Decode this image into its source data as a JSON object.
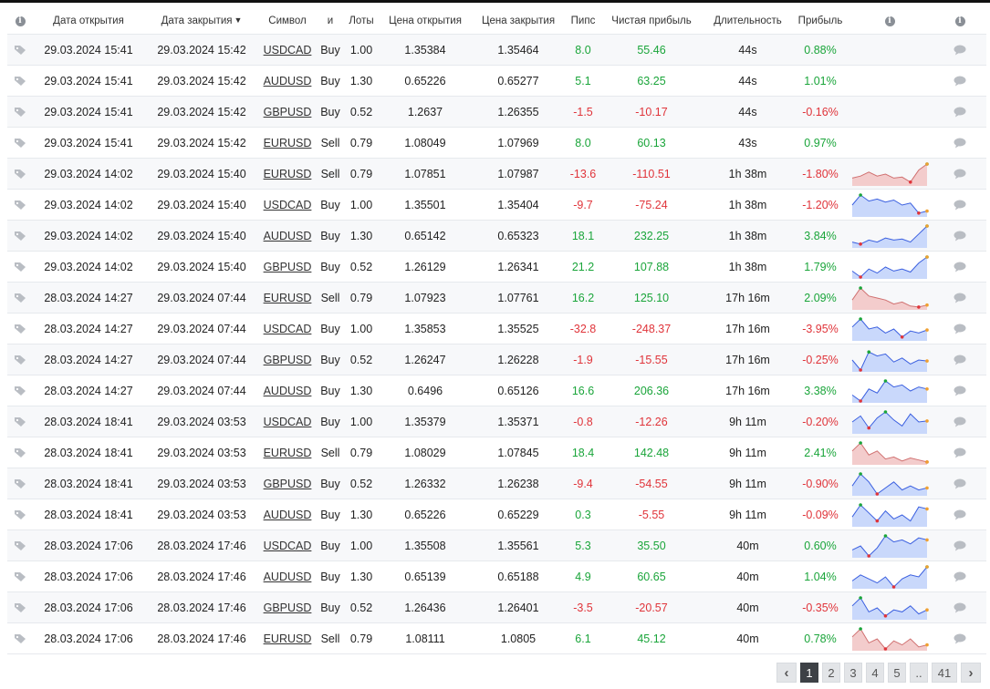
{
  "headers": {
    "open_date": "Дата открытия",
    "close_date": "Дата закрытия",
    "sort_glyph": "▼",
    "symbol": "Символ",
    "side": "и",
    "lots": "Лоты",
    "open_price": "Цена открытия",
    "close_price": "Цена закрытия",
    "pips": "Пипс",
    "net_profit": "Чистая прибыль",
    "duration": "Длительность",
    "gain": "Прибыль"
  },
  "colors": {
    "positive": "#1aa53a",
    "negative": "#e0343a",
    "spark_gain_fill": "#c9d8fb",
    "spark_gain_line": "#3a5fe0",
    "spark_loss_fill": "#f3cccc",
    "spark_loss_line": "#d07070"
  },
  "rows": [
    {
      "open": "29.03.2024 15:41",
      "close": "29.03.2024 15:42",
      "symbol": "USDCAD",
      "side": "Buy",
      "lots": "1.00",
      "open_price": "1.35384",
      "close_price": "1.35464",
      "pips": "8.0",
      "profit": "55.46",
      "duration": "44s",
      "gain": "0.88%",
      "sign": "pos",
      "spark": null
    },
    {
      "open": "29.03.2024 15:41",
      "close": "29.03.2024 15:42",
      "symbol": "AUDUSD",
      "side": "Buy",
      "lots": "1.30",
      "open_price": "0.65226",
      "close_price": "0.65277",
      "pips": "5.1",
      "profit": "63.25",
      "duration": "44s",
      "gain": "1.01%",
      "sign": "pos",
      "spark": null
    },
    {
      "open": "29.03.2024 15:41",
      "close": "29.03.2024 15:42",
      "symbol": "GBPUSD",
      "side": "Buy",
      "lots": "0.52",
      "open_price": "1.2637",
      "close_price": "1.26355",
      "pips": "-1.5",
      "profit": "-10.17",
      "duration": "44s",
      "gain": "-0.16%",
      "sign": "neg",
      "spark": null
    },
    {
      "open": "29.03.2024 15:41",
      "close": "29.03.2024 15:42",
      "symbol": "EURUSD",
      "side": "Sell",
      "lots": "0.79",
      "open_price": "1.08049",
      "close_price": "1.07969",
      "pips": "8.0",
      "profit": "60.13",
      "duration": "43s",
      "gain": "0.97%",
      "sign": "pos",
      "spark": null
    },
    {
      "open": "29.03.2024 14:02",
      "close": "29.03.2024 15:40",
      "symbol": "EURUSD",
      "side": "Sell",
      "lots": "0.79",
      "open_price": "1.07851",
      "close_price": "1.07987",
      "pips": "-13.6",
      "profit": "-110.51",
      "duration": "1h 38m",
      "gain": "-1.80%",
      "sign": "neg",
      "spark": "loss",
      "sv": [
        0.3,
        0.4,
        0.6,
        0.4,
        0.5,
        0.3,
        0.35,
        0.1,
        0.7,
        1.0
      ]
    },
    {
      "open": "29.03.2024 14:02",
      "close": "29.03.2024 15:40",
      "symbol": "USDCAD",
      "side": "Buy",
      "lots": "1.00",
      "open_price": "1.35501",
      "close_price": "1.35404",
      "pips": "-9.7",
      "profit": "-75.24",
      "duration": "1h 38m",
      "gain": "-1.20%",
      "sign": "neg",
      "spark": "gain",
      "sv": [
        0.5,
        1.0,
        0.7,
        0.8,
        0.65,
        0.75,
        0.5,
        0.6,
        0.1,
        0.2
      ]
    },
    {
      "open": "29.03.2024 14:02",
      "close": "29.03.2024 15:40",
      "symbol": "AUDUSD",
      "side": "Buy",
      "lots": "1.30",
      "open_price": "0.65142",
      "close_price": "0.65323",
      "pips": "18.1",
      "profit": "232.25",
      "duration": "1h 38m",
      "gain": "3.84%",
      "sign": "pos",
      "spark": "gain",
      "sv": [
        0.2,
        0.1,
        0.3,
        0.2,
        0.4,
        0.3,
        0.35,
        0.2,
        0.6,
        1.0
      ]
    },
    {
      "open": "29.03.2024 14:02",
      "close": "29.03.2024 15:40",
      "symbol": "GBPUSD",
      "side": "Buy",
      "lots": "0.52",
      "open_price": "1.26129",
      "close_price": "1.26341",
      "pips": "21.2",
      "profit": "107.88",
      "duration": "1h 38m",
      "gain": "1.79%",
      "sign": "pos",
      "spark": "gain",
      "sv": [
        0.3,
        0.0,
        0.4,
        0.2,
        0.5,
        0.3,
        0.4,
        0.25,
        0.7,
        1.0
      ]
    },
    {
      "open": "28.03.2024 14:27",
      "close": "29.03.2024 07:44",
      "symbol": "EURUSD",
      "side": "Sell",
      "lots": "0.79",
      "open_price": "1.07923",
      "close_price": "1.07761",
      "pips": "16.2",
      "profit": "125.10",
      "duration": "17h 16m",
      "gain": "2.09%",
      "sign": "pos",
      "spark": "loss",
      "sv": [
        0.4,
        1.0,
        0.6,
        0.5,
        0.4,
        0.2,
        0.3,
        0.1,
        0.05,
        0.15
      ]
    },
    {
      "open": "28.03.2024 14:27",
      "close": "29.03.2024 07:44",
      "symbol": "USDCAD",
      "side": "Buy",
      "lots": "1.00",
      "open_price": "1.35853",
      "close_price": "1.35525",
      "pips": "-32.8",
      "profit": "-248.37",
      "duration": "17h 16m",
      "gain": "-3.95%",
      "sign": "neg",
      "spark": "gain",
      "sv": [
        0.6,
        1.0,
        0.5,
        0.6,
        0.3,
        0.5,
        0.1,
        0.4,
        0.3,
        0.45
      ]
    },
    {
      "open": "28.03.2024 14:27",
      "close": "29.03.2024 07:44",
      "symbol": "GBPUSD",
      "side": "Buy",
      "lots": "0.52",
      "open_price": "1.26247",
      "close_price": "1.26228",
      "pips": "-1.9",
      "profit": "-15.55",
      "duration": "17h 16m",
      "gain": "-0.25%",
      "sign": "neg",
      "spark": "gain",
      "sv": [
        0.5,
        0.0,
        0.9,
        0.7,
        0.8,
        0.4,
        0.6,
        0.3,
        0.5,
        0.45
      ]
    },
    {
      "open": "28.03.2024 14:27",
      "close": "29.03.2024 07:44",
      "symbol": "AUDUSD",
      "side": "Buy",
      "lots": "1.30",
      "open_price": "0.6496",
      "close_price": "0.65126",
      "pips": "16.6",
      "profit": "206.36",
      "duration": "17h 16m",
      "gain": "3.38%",
      "sign": "pos",
      "spark": "gain",
      "sv": [
        0.3,
        0.0,
        0.6,
        0.4,
        1.0,
        0.7,
        0.8,
        0.5,
        0.7,
        0.6
      ]
    },
    {
      "open": "28.03.2024 18:41",
      "close": "29.03.2024 03:53",
      "symbol": "USDCAD",
      "side": "Buy",
      "lots": "1.00",
      "open_price": "1.35379",
      "close_price": "1.35371",
      "pips": "-0.8",
      "profit": "-12.26",
      "duration": "9h 11m",
      "gain": "-0.20%",
      "sign": "neg",
      "spark": "gain",
      "sv": [
        0.5,
        0.8,
        0.2,
        0.7,
        1.0,
        0.6,
        0.3,
        0.9,
        0.5,
        0.55
      ]
    },
    {
      "open": "28.03.2024 18:41",
      "close": "29.03.2024 03:53",
      "symbol": "EURUSD",
      "side": "Sell",
      "lots": "0.79",
      "open_price": "1.08029",
      "close_price": "1.07845",
      "pips": "18.4",
      "profit": "142.48",
      "duration": "9h 11m",
      "gain": "2.41%",
      "sign": "pos",
      "spark": "loss",
      "sv": [
        0.6,
        1.0,
        0.4,
        0.6,
        0.2,
        0.3,
        0.1,
        0.25,
        0.15,
        0.05
      ]
    },
    {
      "open": "28.03.2024 18:41",
      "close": "29.03.2024 03:53",
      "symbol": "GBPUSD",
      "side": "Buy",
      "lots": "0.52",
      "open_price": "1.26332",
      "close_price": "1.26238",
      "pips": "-9.4",
      "profit": "-54.55",
      "duration": "9h 11m",
      "gain": "-0.90%",
      "sign": "neg",
      "spark": "gain",
      "sv": [
        0.4,
        1.0,
        0.6,
        0.0,
        0.3,
        0.6,
        0.2,
        0.4,
        0.2,
        0.3
      ]
    },
    {
      "open": "28.03.2024 18:41",
      "close": "29.03.2024 03:53",
      "symbol": "AUDUSD",
      "side": "Buy",
      "lots": "1.30",
      "open_price": "0.65226",
      "close_price": "0.65229",
      "pips": "0.3",
      "profit": "-5.55",
      "duration": "9h 11m",
      "gain": "-0.09%",
      "sign": "neg",
      "spark": "gain",
      "sv": [
        0.4,
        1.0,
        0.6,
        0.2,
        0.7,
        0.3,
        0.5,
        0.2,
        0.9,
        0.8
      ]
    },
    {
      "open": "28.03.2024 17:06",
      "close": "28.03.2024 17:46",
      "symbol": "USDCAD",
      "side": "Buy",
      "lots": "1.00",
      "open_price": "1.35508",
      "close_price": "1.35561",
      "pips": "5.3",
      "profit": "35.50",
      "duration": "40m",
      "gain": "0.60%",
      "sign": "pos",
      "spark": "gain",
      "sv": [
        0.3,
        0.5,
        0.0,
        0.4,
        1.0,
        0.7,
        0.8,
        0.6,
        0.9,
        0.8
      ]
    },
    {
      "open": "28.03.2024 17:06",
      "close": "28.03.2024 17:46",
      "symbol": "AUDUSD",
      "side": "Buy",
      "lots": "1.30",
      "open_price": "0.65139",
      "close_price": "0.65188",
      "pips": "4.9",
      "profit": "60.65",
      "duration": "40m",
      "gain": "1.04%",
      "sign": "pos",
      "spark": "gain",
      "sv": [
        0.3,
        0.6,
        0.4,
        0.2,
        0.5,
        0.0,
        0.4,
        0.6,
        0.5,
        1.0
      ]
    },
    {
      "open": "28.03.2024 17:06",
      "close": "28.03.2024 17:46",
      "symbol": "GBPUSD",
      "side": "Buy",
      "lots": "0.52",
      "open_price": "1.26436",
      "close_price": "1.26401",
      "pips": "-3.5",
      "profit": "-20.57",
      "duration": "40m",
      "gain": "-0.35%",
      "sign": "neg",
      "spark": "gain",
      "sv": [
        0.6,
        1.0,
        0.3,
        0.5,
        0.1,
        0.4,
        0.3,
        0.6,
        0.2,
        0.4
      ]
    },
    {
      "open": "28.03.2024 17:06",
      "close": "28.03.2024 17:46",
      "symbol": "EURUSD",
      "side": "Sell",
      "lots": "0.79",
      "open_price": "1.08111",
      "close_price": "1.0805",
      "pips": "6.1",
      "profit": "45.12",
      "duration": "40m",
      "gain": "0.78%",
      "sign": "pos",
      "spark": "loss",
      "sv": [
        0.6,
        1.0,
        0.3,
        0.5,
        0.0,
        0.4,
        0.2,
        0.5,
        0.1,
        0.2
      ]
    }
  ],
  "pagination": {
    "prev": "‹",
    "pages": [
      "1",
      "2",
      "3",
      "4",
      "5"
    ],
    "ellipsis": "..",
    "last": "41",
    "next": "›",
    "current": "1"
  },
  "icons": {
    "info": "info-icon",
    "tag": "tag-icon",
    "comment": "comment-icon"
  }
}
